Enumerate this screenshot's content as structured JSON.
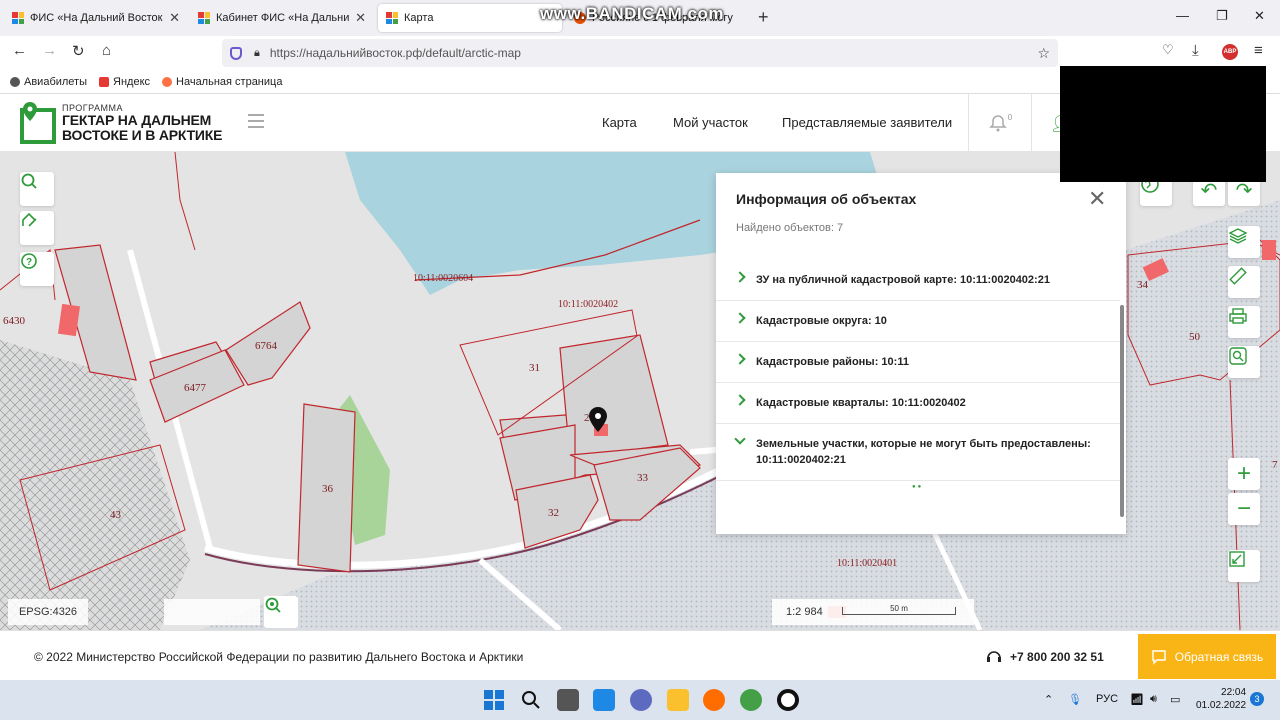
{
  "browser": {
    "tabs": [
      {
        "label": "ФИС «На Дальний Восток»"
      },
      {
        "label": "Кабинет ФИС «На Дальний Во"
      },
      {
        "label": "Карта"
      },
      {
        "label": "Россияне с 1 февраля могу"
      }
    ],
    "url": "https://надальнийвосток.рф/default/arctic-map",
    "overlay_watermark": "www.BANDICAM.com",
    "bookmarks": [
      {
        "label": "Авиабилеты"
      },
      {
        "label": "Яндекс"
      },
      {
        "label": "Начальная страница"
      }
    ],
    "adblock_label": "ABP"
  },
  "site": {
    "logo": {
      "small": "ПРОГРАММА",
      "line1": "ГЕКТАР НА ДАЛЬНЕМ",
      "line2": "ВОСТОКЕ И В АРКТИКЕ"
    },
    "nav": [
      {
        "label": "Карта"
      },
      {
        "label": "Мой участок"
      },
      {
        "label": "Представляемые заявители"
      }
    ],
    "notification_count": "0"
  },
  "map": {
    "epsg": "EPSG:4326",
    "scale": "1:2 984",
    "scale_bar_label": "50 m",
    "labels": {
      "block_604": "10:11:0020604",
      "block_402": "10:11:0020402",
      "block_401": "10:11:0020401",
      "p6430": "6430",
      "p6764": "6764",
      "p6477": "6477",
      "p36": "36",
      "p43": "43",
      "p31": "31",
      "p2": "2",
      "p33": "33",
      "p32": "32",
      "p34": "34",
      "p50": "50",
      "p7": "7"
    }
  },
  "panel": {
    "title": "Информация об объектах",
    "found": "Найдено объектов: 7",
    "items": [
      {
        "label": "ЗУ на публичной кадастровой карте: 10:11:0020402:21"
      },
      {
        "label": "Кадастровые округа: 10"
      },
      {
        "label": "Кадастровые районы: 10:11"
      },
      {
        "label": "Кадастровые кварталы: 10:11:0020402"
      },
      {
        "label": "Земельные участки, которые не могут быть предоставлены: 10:11:0020402:21"
      }
    ]
  },
  "footer": {
    "copyright": "© 2022 Министерство Российской Федерации по развитию Дальнего Востока и Арктики",
    "phone": "+7 800 200 32 51",
    "feedback": "Обратная связь"
  },
  "taskbar": {
    "lang": "РУС",
    "time": "22:04",
    "date": "01.02.2022",
    "notifications": "3"
  },
  "colors": {
    "brand_green": "#2e9b3a",
    "feedback_yellow": "#f9b515",
    "parcel_red": "#c0272d",
    "water": "#a9d3de"
  }
}
